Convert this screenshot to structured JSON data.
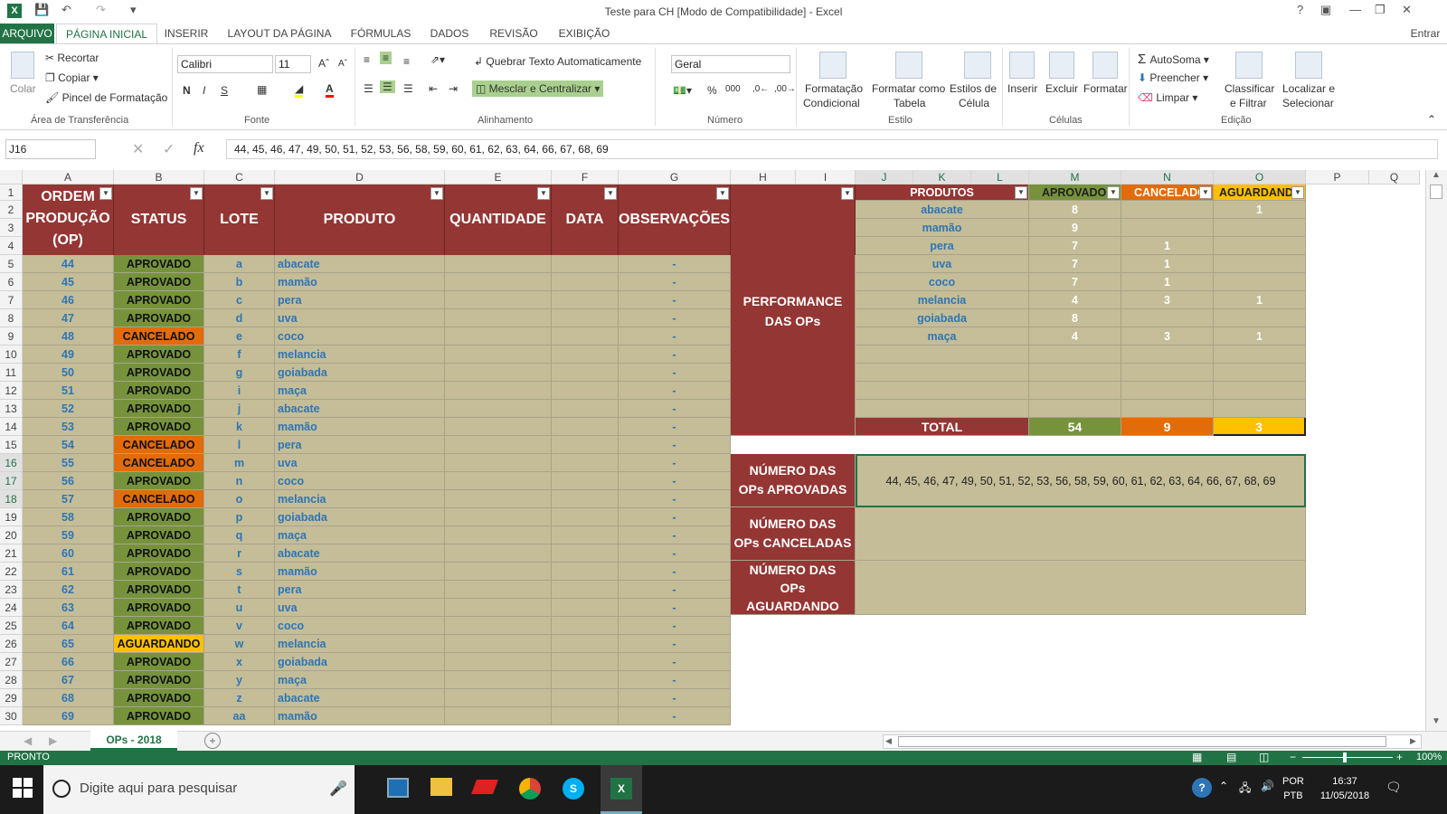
{
  "window": {
    "title": "Teste para CH  [Modo de Compatibilidade] - Excel",
    "help": "?",
    "minimize": "—",
    "restore": "❐",
    "close": "✕",
    "signin": "Entrar"
  },
  "colors": {
    "excel_green": "#217346",
    "maroon": "#943634",
    "tan": "#c4bd97",
    "approved": "#76933c",
    "canceled": "#e26b0a",
    "waiting": "#ffc000",
    "blue_text": "#2e75b6"
  },
  "tabs": [
    "ARQUIVO",
    "PÁGINA INICIAL",
    "INSERIR",
    "LAYOUT DA PÁGINA",
    "FÓRMULAS",
    "DADOS",
    "REVISÃO",
    "EXIBIÇÃO"
  ],
  "ribbon": {
    "clipboard": {
      "paste": "Colar",
      "cut": "Recortar",
      "copy": "Copiar",
      "painter": "Pincel de Formatação",
      "label": "Área de Transferência"
    },
    "font": {
      "name": "Calibri",
      "size": "11",
      "bold": "N",
      "italic": "I",
      "underline": "S",
      "label": "Fonte"
    },
    "alignment": {
      "wrap": "Quebrar Texto Automaticamente",
      "merge": "Mesclar e Centralizar",
      "label": "Alinhamento"
    },
    "number": {
      "format": "Geral",
      "percent": "%",
      "thousands": "000",
      "label": "Número"
    },
    "styles": {
      "cond1": "Formatação",
      "cond2": "Condicional",
      "table1": "Formatar como",
      "table2": "Tabela",
      "cell1": "Estilos de",
      "cell2": "Célula",
      "label": "Estilo"
    },
    "cells": {
      "insert": "Inserir",
      "delete": "Excluir",
      "format": "Formatar",
      "label": "Células"
    },
    "editing": {
      "autosum": "AutoSoma",
      "fill": "Preencher",
      "clear": "Limpar",
      "sort1": "Classificar",
      "sort2": "e Filtrar",
      "find1": "Localizar e",
      "find2": "Selecionar",
      "label": "Edição"
    }
  },
  "formula_bar": {
    "name_box": "J16",
    "fx": "fx",
    "value": "44, 45, 46, 47, 49, 50, 51, 52, 53, 56, 58, 59, 60, 61, 62, 63, 64, 66, 67, 68, 69"
  },
  "columns": [
    "A",
    "B",
    "C",
    "D",
    "E",
    "F",
    "G",
    "H",
    "I",
    "J",
    "K",
    "L",
    "M",
    "N",
    "O",
    "P",
    "Q"
  ],
  "header": {
    "op1": "ORDEM",
    "op2": "PRODUÇÃO",
    "op3": "(OP)",
    "status": "STATUS",
    "lote": "LOTE",
    "produto": "PRODUTO",
    "quantidade": "QUANTIDADE",
    "data": "DATA",
    "obs": "OBSERVAÇÕES"
  },
  "rows": [
    {
      "op": "44",
      "status": "APROVADO",
      "lote": "a",
      "produto": "abacate",
      "obs": "-"
    },
    {
      "op": "45",
      "status": "APROVADO",
      "lote": "b",
      "produto": "mamão",
      "obs": "-"
    },
    {
      "op": "46",
      "status": "APROVADO",
      "lote": "c",
      "produto": "pera",
      "obs": "-"
    },
    {
      "op": "47",
      "status": "APROVADO",
      "lote": "d",
      "produto": "uva",
      "obs": "-"
    },
    {
      "op": "48",
      "status": "CANCELADO",
      "lote": "e",
      "produto": "coco",
      "obs": "-"
    },
    {
      "op": "49",
      "status": "APROVADO",
      "lote": "f",
      "produto": "melancia",
      "obs": "-"
    },
    {
      "op": "50",
      "status": "APROVADO",
      "lote": "g",
      "produto": "goiabada",
      "obs": "-"
    },
    {
      "op": "51",
      "status": "APROVADO",
      "lote": "i",
      "produto": "maça",
      "obs": "-"
    },
    {
      "op": "52",
      "status": "APROVADO",
      "lote": "j",
      "produto": "abacate",
      "obs": "-"
    },
    {
      "op": "53",
      "status": "APROVADO",
      "lote": "k",
      "produto": "mamão",
      "obs": "-"
    },
    {
      "op": "54",
      "status": "CANCELADO",
      "lote": "l",
      "produto": "pera",
      "obs": "-"
    },
    {
      "op": "55",
      "status": "CANCELADO",
      "lote": "m",
      "produto": "uva",
      "obs": "-"
    },
    {
      "op": "56",
      "status": "APROVADO",
      "lote": "n",
      "produto": "coco",
      "obs": "-"
    },
    {
      "op": "57",
      "status": "CANCELADO",
      "lote": "o",
      "produto": "melancia",
      "obs": "-"
    },
    {
      "op": "58",
      "status": "APROVADO",
      "lote": "p",
      "produto": "goiabada",
      "obs": "-"
    },
    {
      "op": "59",
      "status": "APROVADO",
      "lote": "q",
      "produto": "maça",
      "obs": "-"
    },
    {
      "op": "60",
      "status": "APROVADO",
      "lote": "r",
      "produto": "abacate",
      "obs": "-"
    },
    {
      "op": "61",
      "status": "APROVADO",
      "lote": "s",
      "produto": "mamão",
      "obs": "-"
    },
    {
      "op": "62",
      "status": "APROVADO",
      "lote": "t",
      "produto": "pera",
      "obs": "-"
    },
    {
      "op": "63",
      "status": "APROVADO",
      "lote": "u",
      "produto": "uva",
      "obs": "-"
    },
    {
      "op": "64",
      "status": "APROVADO",
      "lote": "v",
      "produto": "coco",
      "obs": "-"
    },
    {
      "op": "65",
      "status": "AGUARDANDO",
      "lote": "w",
      "produto": "melancia",
      "obs": "-"
    },
    {
      "op": "66",
      "status": "APROVADO",
      "lote": "x",
      "produto": "goiabada",
      "obs": "-"
    },
    {
      "op": "67",
      "status": "APROVADO",
      "lote": "y",
      "produto": "maça",
      "obs": "-"
    },
    {
      "op": "68",
      "status": "APROVADO",
      "lote": "z",
      "produto": "abacate",
      "obs": "-"
    },
    {
      "op": "69",
      "status": "APROVADO",
      "lote": "aa",
      "produto": "mamão",
      "obs": "-"
    }
  ],
  "performance": {
    "label1": "PERFORMANCE",
    "label2": "DAS OPs"
  },
  "summary": {
    "headers": {
      "produtos": "PRODUTOS",
      "aprovado": "APROVADO",
      "cancelado": "CANCELADO",
      "aguardando": "AGUARDANDO"
    },
    "rows": [
      {
        "produto": "abacate",
        "aprovado": "8",
        "cancelado": "",
        "aguardando": "1"
      },
      {
        "produto": "mamão",
        "aprovado": "9",
        "cancelado": "",
        "aguardando": ""
      },
      {
        "produto": "pera",
        "aprovado": "7",
        "cancelado": "1",
        "aguardando": ""
      },
      {
        "produto": "uva",
        "aprovado": "7",
        "cancelado": "1",
        "aguardando": ""
      },
      {
        "produto": "coco",
        "aprovado": "7",
        "cancelado": "1",
        "aguardando": ""
      },
      {
        "produto": "melancia",
        "aprovado": "4",
        "cancelado": "3",
        "aguardando": "1"
      },
      {
        "produto": "goiabada",
        "aprovado": "8",
        "cancelado": "",
        "aguardando": ""
      },
      {
        "produto": "maça",
        "aprovado": "4",
        "cancelado": "3",
        "aguardando": "1"
      },
      {
        "produto": "",
        "aprovado": "",
        "cancelado": "",
        "aguardando": ""
      },
      {
        "produto": "",
        "aprovado": "",
        "cancelado": "",
        "aguardando": ""
      },
      {
        "produto": "",
        "aprovado": "",
        "cancelado": "",
        "aguardando": ""
      },
      {
        "produto": "",
        "aprovado": "",
        "cancelado": "",
        "aguardando": ""
      }
    ],
    "total": {
      "label": "TOTAL",
      "aprovado": "54",
      "cancelado": "9",
      "aguardando": "3"
    }
  },
  "ops_lists": {
    "aprovadas_l1": "NÚMERO DAS",
    "aprovadas_l2": "OPs APROVADAS",
    "aprovadas_value": "44, 45, 46, 47, 49, 50, 51, 52, 53, 56, 58, 59, 60, 61, 62, 63, 64, 66, 67, 68, 69",
    "canceladas_l1": "NÚMERO DAS",
    "canceladas_l2": "OPs CANCELADAS",
    "canceladas_value": "",
    "aguardando_l1": "NÚMERO DAS",
    "aguardando_l2": "OPs",
    "aguardando_l3": "AGUARDANDO",
    "aguardando_value": ""
  },
  "sheet_tab": "OPs - 2018",
  "status": {
    "mode": "PRONTO",
    "zoom": "100%"
  },
  "taskbar": {
    "search": "Digite aqui para pesquisar",
    "lang1": "POR",
    "lang2": "PTB",
    "time": "16:37",
    "date": "11/05/2018"
  }
}
